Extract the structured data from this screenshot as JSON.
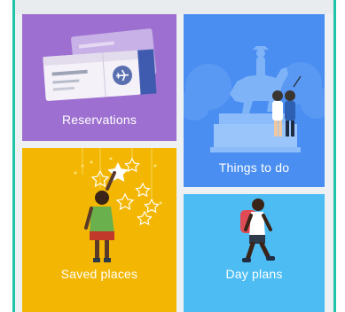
{
  "tiles": {
    "reservations": {
      "label": "Reservations",
      "color": "#9d6fd0",
      "icon": "plane-ticket-icon"
    },
    "things_to_do": {
      "label": "Things to do",
      "color": "#4a8ef2",
      "icon": "statue-selfie-icon"
    },
    "saved_places": {
      "label": "Saved places",
      "color": "#f3b703",
      "icon": "star-reach-icon"
    },
    "day_plans": {
      "label": "Day plans",
      "color": "#4cbcf3",
      "icon": "hiker-icon"
    }
  }
}
